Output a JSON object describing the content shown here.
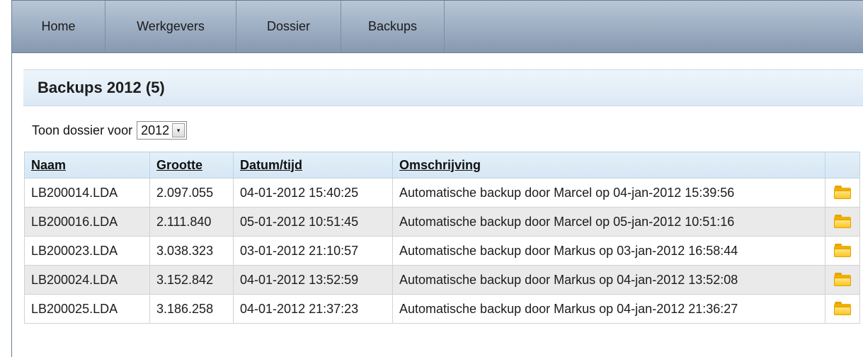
{
  "nav": {
    "items": [
      "Home",
      "Werkgevers",
      "Dossier",
      "Backups"
    ]
  },
  "page_title": "Backups 2012 (5)",
  "filter": {
    "label": "Toon dossier voor",
    "year": "2012"
  },
  "table": {
    "headers": [
      "Naam",
      "Grootte",
      "Datum/tijd",
      "Omschrijving"
    ],
    "rows": [
      [
        "LB200014.LDA",
        "2.097.055",
        "04-01-2012 15:40:25",
        "Automatische backup door Marcel op 04-jan-2012 15:39:56"
      ],
      [
        "LB200016.LDA",
        "2.111.840",
        "05-01-2012 10:51:45",
        "Automatische backup door Marcel op 05-jan-2012 10:51:16"
      ],
      [
        "LB200023.LDA",
        "3.038.323",
        "03-01-2012 21:10:57",
        "Automatische backup door Markus op 03-jan-2012 16:58:44"
      ],
      [
        "LB200024.LDA",
        "3.152.842",
        "04-01-2012 13:52:59",
        "Automatische backup door Markus op 04-jan-2012 13:52:08"
      ],
      [
        "LB200025.LDA",
        "3.186.258",
        "04-01-2012 21:37:23",
        "Automatische backup door Markus op 04-jan-2012 21:36:27"
      ]
    ],
    "row_icon": "folder-icon"
  },
  "colors": {
    "nav_bg": "#a1b2c6",
    "title_bg": "#dbe9f5",
    "row_alt_bg": "#eaeaea",
    "folder": "#ffc51a"
  }
}
